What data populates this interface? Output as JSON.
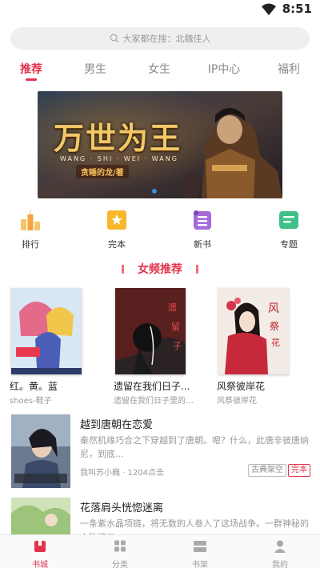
{
  "status_bar": {
    "time": "8:51"
  },
  "search": {
    "placeholder": "大家都在搜：北魏佳人"
  },
  "tabs": [
    {
      "label": "推荐",
      "active": true
    },
    {
      "label": "男生",
      "active": false
    },
    {
      "label": "女生",
      "active": false
    },
    {
      "label": "IP中心",
      "active": false
    },
    {
      "label": "福利",
      "active": false
    }
  ],
  "banner": {
    "title": "万世为王",
    "pinyin": "WANG · SHI · WEI · WANG",
    "author": "贪睡的龙/著"
  },
  "quick_links": [
    {
      "label": "排行",
      "icon": "ranking-trophy-icon",
      "color": "#f4a340"
    },
    {
      "label": "完本",
      "icon": "completed-book-icon",
      "color": "#f7b82b"
    },
    {
      "label": "新书",
      "icon": "new-book-icon",
      "color": "#a46bd9"
    },
    {
      "label": "专题",
      "icon": "topic-icon",
      "color": "#3fbf8a"
    }
  ],
  "section": {
    "title": "女频推荐"
  },
  "grid_books": [
    {
      "title": "红。黄。蓝",
      "author": "shoes-鞋子"
    },
    {
      "title": "遗留在我们日子...",
      "author": "遗留在我们日子里的朱..."
    },
    {
      "title": "风祭彼岸花",
      "author": "风祭彼岸花"
    }
  ],
  "list_books": [
    {
      "title": "越到唐朝在恋爱",
      "desc": "秦然机缘巧合之下穿越到了唐朝。嗯？什么，此唐非彼唐纳尼，到底...",
      "meta": "我叫苏小巍 · 1204点击",
      "tags": [
        "古典架空",
        "完本"
      ]
    },
    {
      "title": "花落肩头恍惚迷离",
      "desc": "一条紫水晶项链，将无数的人卷入了这场战争。一群神秘的人物接二...",
      "meta": "",
      "tags": []
    }
  ],
  "bottom_nav": [
    {
      "label": "书城",
      "active": true
    },
    {
      "label": "分类",
      "active": false
    },
    {
      "label": "书架",
      "active": false
    },
    {
      "label": "我的",
      "active": false
    }
  ],
  "colors": {
    "accent": "#e2344b"
  }
}
